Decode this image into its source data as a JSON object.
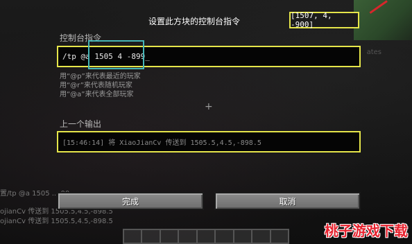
{
  "screen": {
    "title": "设置此方块的控制台指令",
    "coords": "[1507, 4, -900]"
  },
  "command": {
    "label": "控制台指令",
    "value": "/tp @a 1505 4 -899_"
  },
  "hints": [
    "用“@p”来代表最近的玩家",
    "用“@r”来代表随机玩家",
    "用“@a”来代表全部玩家"
  ],
  "output": {
    "label": "上一个输出",
    "value": "[15:46:14] 将 XiaoJianCv 传送到 1505.5,4.5,-898.5"
  },
  "chat": [
    "置/tp @a 1505 ... 00",
    "ojianCv 传送到 1505.5,4.5,-898.5",
    "ojianCv 传送到 1505.5,4.5,-898.5"
  ],
  "buttons": {
    "done": "完成",
    "cancel": "取消"
  },
  "watermark": "桃子游戏下载",
  "background_text": "ates",
  "colors": {
    "highlight_yellow": "#e6e64a",
    "highlight_cyan": "#46b6b7",
    "watermark_red": "#e6222e"
  }
}
